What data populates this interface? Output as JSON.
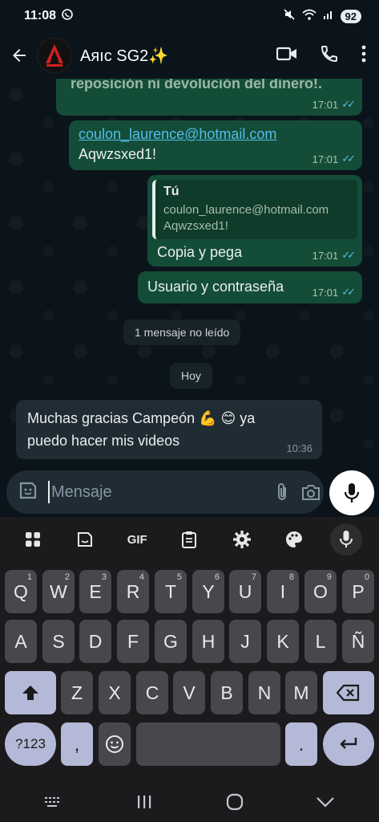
{
  "status_bar": {
    "time": "11:08",
    "battery": "92"
  },
  "header": {
    "contact_name": "Aяıc SG2✨"
  },
  "messages": {
    "partial_text": "reposición ni devolución del dinero!.",
    "partial_time": "17:01",
    "email_link": "coulon_laurence@hotmail.com",
    "email_password": "Aqwzsxed1!",
    "email_time": "17:01",
    "reply_quote_author": "Tú",
    "reply_quote_line1": "coulon_laurence@hotmail.com",
    "reply_quote_line2": "Aqwzsxed1!",
    "reply_text": "Copia y pega",
    "reply_time": "17:01",
    "userpass_text": "Usuario y contraseña",
    "userpass_time": "17:01",
    "unread_banner": "1 mensaje no leído",
    "date_pill": "Hoy",
    "incoming_line1": "Muchas gracias Campeón 💪 😊 ya",
    "incoming_line2": "puedo hacer mis videos",
    "incoming_time": "10:36"
  },
  "composer": {
    "placeholder": "Mensaje"
  },
  "keyboard": {
    "toolbar_gif": "GIF",
    "row1": [
      {
        "k": "Q",
        "h": "1"
      },
      {
        "k": "W",
        "h": "2"
      },
      {
        "k": "E",
        "h": "3"
      },
      {
        "k": "R",
        "h": "4"
      },
      {
        "k": "T",
        "h": "5"
      },
      {
        "k": "Y",
        "h": "6"
      },
      {
        "k": "U",
        "h": "7"
      },
      {
        "k": "I",
        "h": "8"
      },
      {
        "k": "O",
        "h": "9"
      },
      {
        "k": "P",
        "h": "0"
      }
    ],
    "row2": [
      "A",
      "S",
      "D",
      "F",
      "G",
      "H",
      "J",
      "K",
      "L",
      "Ñ"
    ],
    "row3": [
      "Z",
      "X",
      "C",
      "V",
      "B",
      "N",
      "M"
    ],
    "sym_key": "?123",
    "comma_key": ",",
    "period_key": "."
  },
  "icons": {
    "back": "arrow-left-icon",
    "video": "video-call-icon",
    "call": "phone-icon",
    "menu": "more-vert-icon",
    "sticker": "sticker-icon",
    "attach": "paperclip-icon",
    "camera": "camera-icon",
    "mic": "mic-icon"
  },
  "colors": {
    "outgoing_bubble": "#144d37",
    "incoming_bubble": "#202c33",
    "read_ticks": "#53bdeb",
    "background": "#0b141a"
  }
}
